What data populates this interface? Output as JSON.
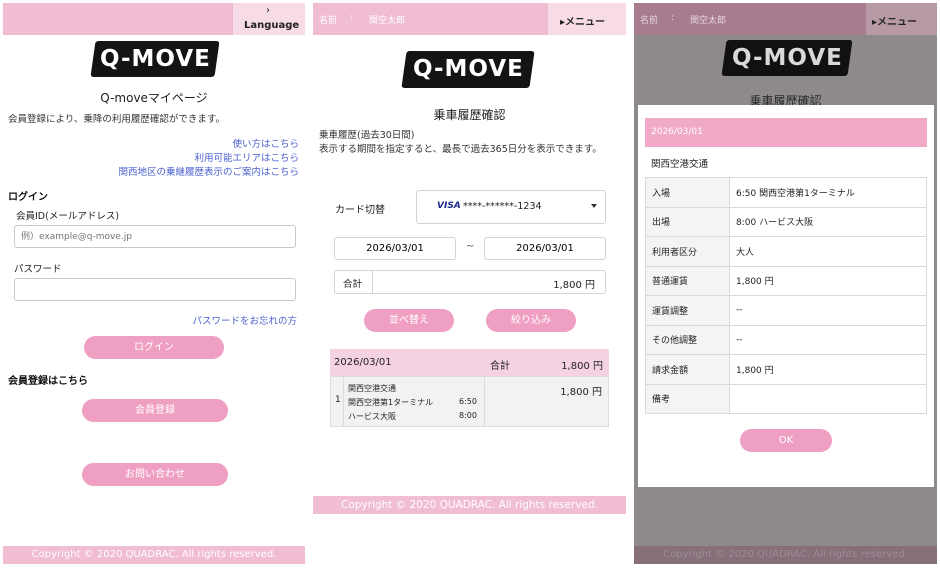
{
  "login": {
    "language_arrow": "›",
    "language": "Language",
    "logo": "Q-MOVE",
    "title": "Q-moveマイページ",
    "description": "会員登録により、乗降の利用履歴確認ができます。",
    "links": [
      "使い方はこちら",
      "利用可能エリアはこちら",
      "関西地区の乗継履歴表示のご案内はこちら"
    ],
    "section_login": "ログイン",
    "member_id_label": "会員ID(メールアドレス)",
    "member_id_placeholder": "例）example@q-move.jp",
    "password_label": "パスワード",
    "forgot_password": "パスワードをお忘れの方",
    "login_button": "ログイン",
    "section_register": "会員登録はこちら",
    "register_button": "会員登録",
    "contact_button": "お問い合わせ",
    "copyright": "Copyright © 2020 QUADRAC. All rights reserved."
  },
  "history": {
    "name_label": "名前",
    "name_sep": ":",
    "name_value": "関空太郎",
    "menu": "▸メニュー",
    "logo": "Q-MOVE",
    "title": "乗車履歴確認",
    "period_title": "乗車履歴(過去30日間)",
    "period_desc": "表示する期間を指定すると、最長で過去365日分を表示できます。",
    "card_switch_label": "カード切替",
    "card_brand": "VISA",
    "card_number": "****-******-1234",
    "date_from": "2026/03/01",
    "date_sep": "~",
    "date_to": "2026/03/01",
    "total_label": "合計",
    "total_value": "1,800 円",
    "sort_button": "並べ替え",
    "filter_button": "絞り込み",
    "result_date": "2026/03/01",
    "result_total_label": "合計",
    "result_total_value": "1,800 円",
    "record": {
      "index": "1",
      "company": "関西空港交通",
      "from_station": "関西空港第1ターミナル",
      "from_time": "6:50",
      "to_station": "ハービス大阪",
      "to_time": "8:00",
      "fare": "1,800 円"
    },
    "copyright": "Copyright © 2020 QUADRAC. All rights reserved."
  },
  "detail": {
    "name_label": "名前",
    "name_sep": ":",
    "name_value": "関空太郎",
    "menu": "▸メニュー",
    "logo": "Q-MOVE",
    "title": "乗車履歴確認",
    "date": "2026/03/01",
    "company": "関西空港交通",
    "rows": [
      {
        "label": "入場",
        "value": "6:50 関西空港第1ターミナル"
      },
      {
        "label": "出場",
        "value": "8:00 ハービス大阪"
      },
      {
        "label": "利用者区分",
        "value": "大人"
      },
      {
        "label": "普通運賃",
        "value": "1,800 円"
      },
      {
        "label": "運賃調整",
        "value": "--"
      },
      {
        "label": "その他調整",
        "value": "--"
      },
      {
        "label": "請求金額",
        "value": "1,800 円"
      },
      {
        "label": "備考",
        "value": ""
      }
    ],
    "ok_button": "OK",
    "copyright": "Copyright © 2020 QUADRAC. All rights reserved."
  }
}
